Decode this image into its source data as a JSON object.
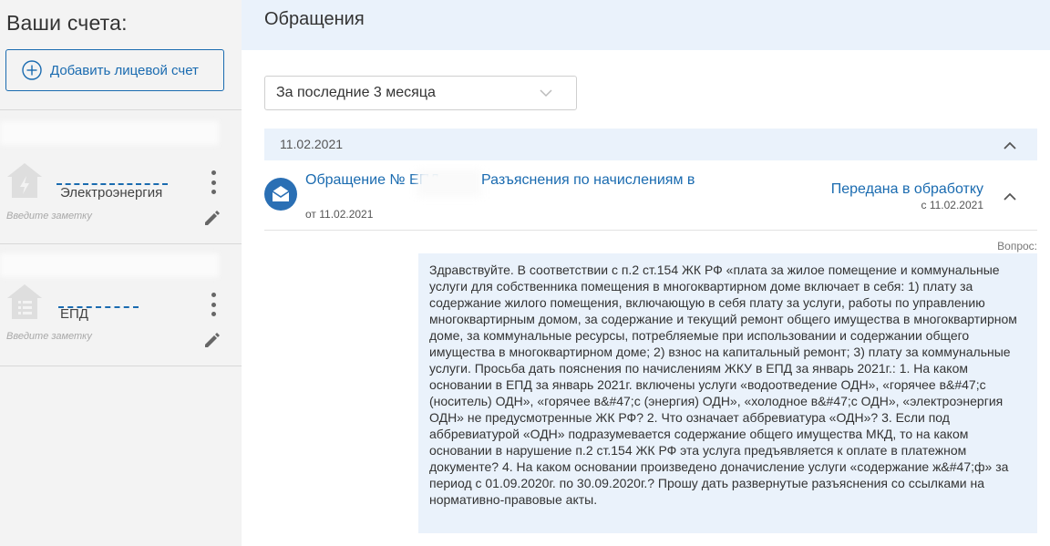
{
  "sidebar": {
    "title": "Ваши счета:",
    "add_button": "Добавить лицевой счет",
    "accounts": [
      {
        "type": "Электроэнергия",
        "note_placeholder": "Введите заметку",
        "icon": "lightning-house-icon"
      },
      {
        "type": "ЕПД",
        "note_placeholder": "Введите заметку",
        "icon": "list-house-icon"
      }
    ]
  },
  "main": {
    "title": "Обращения",
    "period_select": "За последние 3 месяца",
    "group_date": "11.02.2021",
    "request": {
      "title": "Обращение № ЕПД",
      "date": "от 11.02.2021",
      "subject": "Разъяснения по начислениям в",
      "status": "Передана в обработку",
      "status_date": "с 11.02.2021"
    },
    "question_label": "Вопрос:",
    "question_text": "Здравствуйте. В соответствии с п.2 ст.154 ЖК РФ «плата за жилое помещение и коммунальные услуги для собственника помещения в многоквартирном доме включает в себя: 1) плату за содержание жилого помещения, включающую в себя плату за услуги, работы по управлению многоквартирным домом, за содержание и текущий ремонт общего имущества в многоквартирном доме, за коммунальные ресурсы, потребляемые при использовании и содержании общего имущества в многоквартирном доме; 2) взнос на капитальный ремонт; 3) плату за коммунальные услуги. Просьба дать пояснения по начислениям ЖКУ в ЕПД за январь 2021г.: 1. На каком основании в ЕПД за январь 2021г. включены услуги «водоотведение ОДН», «горячее в&#47;с (носитель) ОДН», «горячее в&#47;с (энергия) ОДН», «холодное в&#47;с ОДН», «электроэнергия ОДН» не предусмотренные ЖК РФ? 2. Что означает аббревиатура «ОДН»? 3. Если под аббревиатурой «ОДН» подразумевается содержание общего имущества МКД, то на каком основании в нарушение п.2 ст.154 ЖК РФ эта услуга предъявляется к оплате в платежном документе? 4. На каком основании произведено доначисление услуги «содержание ж&#47;ф» за период с 01.09.2020г. по 30.09.2020г.? Прошу дать развернутые разъяснения со ссылками на нормативно-правовые акты."
  },
  "colors": {
    "accent": "#1a6bb0",
    "sidebar_bg": "#f3f3f3",
    "header_bg": "#eaf2fb",
    "envelope_bg": "#2a6fb4"
  }
}
